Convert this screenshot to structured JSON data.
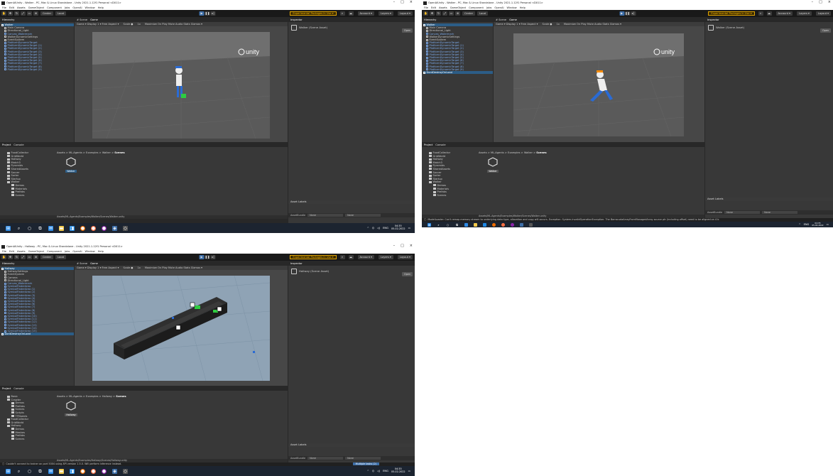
{
  "common": {
    "menu": [
      "File",
      "Edit",
      "Assets",
      "GameObject",
      "Component",
      "Jobs",
      "OpenAI",
      "Window",
      "Help"
    ],
    "toolbar": {
      "center_label": "Center",
      "local_label": "Local",
      "experimental": "Experimental Packages In Use ▾",
      "account": "Account ▾",
      "layers": "Layers ▾",
      "layout": "Layout ▾"
    },
    "hierarchy_tab": "Hierarchy",
    "scene_tab": "# Scene",
    "game_tab": "Game",
    "game_toolbar": {
      "display": "Game ▾  Display 1 ▾  Free Aspect ▾",
      "scale": "Scale ●",
      "scale_value": "1x",
      "options": "Maximize On Play  Mute Audio  Stats  Gizmos ▾"
    },
    "inspector_tab": "Inspector",
    "open_button": "Open",
    "project_tab": "Project",
    "console_tab": "Console",
    "asset_labels": "Asset Labels",
    "asset_bundle_label": "AssetBundle",
    "asset_bundle_value": "None",
    "asset_bundle_variant": "None",
    "window_controls": [
      "–",
      "□",
      "×"
    ],
    "unity_logo_text": "unity",
    "tray": {
      "lang": "ENG",
      "time": "04:35",
      "date": "05-02-2022"
    }
  },
  "shots": {
    "a": {
      "title": "OpenAIUnity - Walker - PC, Mac & Linux Standalone - Unity 2021.1.12f1 Personal <DX11>",
      "scene_name": "Walker",
      "hierarchy": [
        "Main Camera",
        "Directional_Light",
        "Canvas_Watermark",
        "WalkerDynamicSettings",
        "EventSystem",
        "PlatformDynamicTarget",
        "PlatformDynamicTarget (1)",
        "PlatformDynamicTarget (2)",
        "PlatformDynamicTarget (3)",
        "PlatformDynamicTarget (4)",
        "PlatformDynamicTarget (5)",
        "PlatformDynamicTarget (6)",
        "PlatformDynamicTarget (7)",
        "PlatformDynamicTarget (8)",
        "PlatformDynamicTarget (9)"
      ],
      "inspector_title": "Walker (Scene Asset)",
      "breadcrumb": "Assets > ML-Agents > Examples > Walker >",
      "breadcrumb_last": "Scenes",
      "tree": [
        "FoodCollector",
        "GridWorld",
        "Hallway",
        "Match3",
        "Pyramids",
        "SharedAssets",
        "Soccer",
        "Sorter",
        "Startup",
        "Walker",
        "Demos",
        "Materials",
        "Prefabs",
        "Scenes"
      ],
      "asset_name": "Walker",
      "path": "Assets/ML-Agents/Examples/Walker/Scenes/Walker.unity",
      "status": ""
    },
    "b": {
      "title": "OpenAIUnity - Walker - PC, Mac & Linux Standalone - Unity 2021.1.12f1 Personal <DX11>",
      "scene_name": "Walker",
      "hierarchy": [
        "Main Camera",
        "Directional_Light",
        "Canvas_Watermark",
        "WalkerDynamicSettings",
        "EventSystem",
        "PlatformDynamicTarget",
        "PlatformDynamicTarget (1)",
        "PlatformDynamicTarget (2)",
        "PlatformDynamicTarget (3)",
        "PlatformDynamicTarget (4)",
        "PlatformDynamicTarget (5)",
        "PlatformDynamicTarget (6)",
        "PlatformDynamicTarget (7)",
        "PlatformDynamicTarget (8)",
        "PlatformDynamicTarget (9)",
        "DontDestroyOnLoad"
      ],
      "inspector_title": "Walker (Scene Asset)",
      "breadcrumb": "Assets > ML-Agents > Examples > Walker >",
      "breadcrumb_last": "Scenes",
      "tree": [
        "FoodCollector",
        "GridWorld",
        "Hallway",
        "Match3",
        "Pyramids",
        "SharedAssets",
        "Soccer",
        "Sorter",
        "Startup",
        "Walker",
        "Demos",
        "Materials",
        "Prefabs",
        "Scenes"
      ],
      "asset_name": "Walker",
      "path": "Assets/ML-Agents/Examples/Walker/Scenes/Walker.unity",
      "status": "ModelLoader: Can't remap memory stream to underlying data type, allocation and copy will occurs. Exception: System.InvalidOperationException: The BarracudaArrayFromManagedArray source ptr (including offset) need to be aligned on 4 b"
    },
    "c": {
      "title": "OpenAIUnity - Hallway - PC, Mac & Linux Standalone - Unity 2021.1.12f1 Personal <DX11>",
      "scene_name": "Hallway",
      "hierarchy": [
        "HallwaySettings",
        "EventSystem",
        "Camera",
        "Directional_Light",
        "Canvas_Watermark",
        "SymbolFinderArea",
        "SymbolFinderArea (1)",
        "SymbolFinderArea (2)",
        "SymbolFinderArea (3)",
        "SymbolFinderArea (4)",
        "SymbolFinderArea (5)",
        "SymbolFinderArea (6)",
        "SymbolFinderArea (7)",
        "SymbolFinderArea (8)",
        "SymbolFinderArea (9)",
        "SymbolFinderArea (10)",
        "SymbolFinderArea (11)",
        "SymbolFinderArea (12)",
        "SymbolFinderArea (13)",
        "SymbolFinderArea (14)",
        "SymbolFinderArea (15)",
        "DontDestroyOnLoad"
      ],
      "inspector_title": "Hallway (Scene Asset)",
      "breadcrumb": "Assets > ML-Agents > Examples > Hallway >",
      "breadcrumb_last": "Scenes",
      "tree": [
        "Basic",
        "Crawler",
        "Demos",
        "Prefabs",
        "Scenes",
        "Scripts",
        "TFModels",
        "FoodCollector",
        "GridWorld",
        "Hallway",
        "Demos",
        "Meshes",
        "Prefabs",
        "Scenes"
      ],
      "asset_name": "Hallway",
      "path": "Assets/ML-Agents/Examples/Hallway/Scenes/Hallway.unity",
      "status": "Couldn't connect to trainer on port 5004 using API version 1.5.0. Will perform inference instead.",
      "multiple_tasks": "Multiple tasks (2)"
    }
  }
}
